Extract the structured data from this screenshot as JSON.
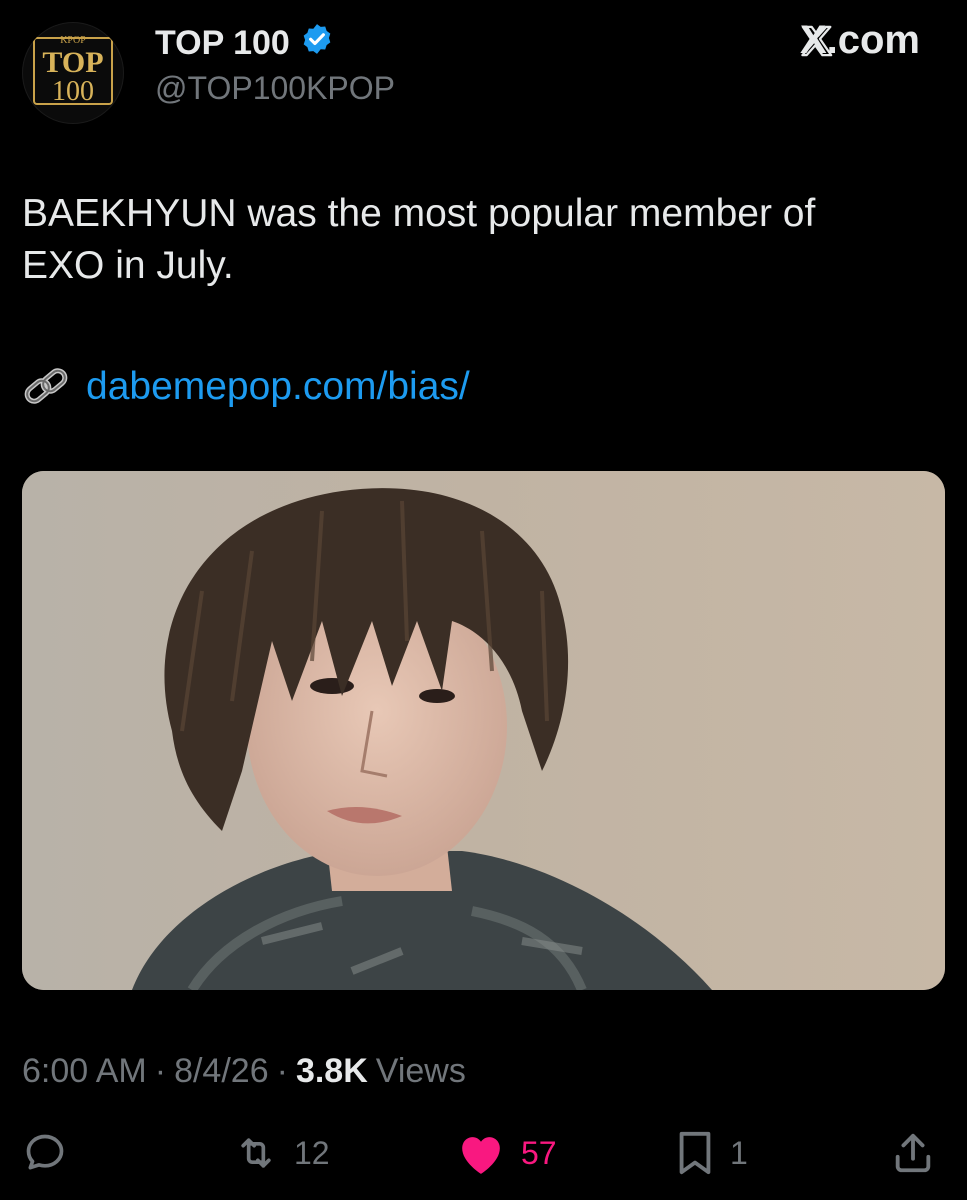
{
  "header": {
    "display_name": "TOP 100",
    "handle": "@TOP100KPOP",
    "verified_icon": "verified-badge-icon",
    "source_label": "X.com",
    "avatar": {
      "small_text": "KPOP",
      "big_text": "TOP",
      "number": "100"
    }
  },
  "tweet": {
    "text_line1": "BAEKHYUN was the most popular member of",
    "text_line2": "EXO in July.",
    "link_icon": "link-icon",
    "link": "dabemepop.com/bias/",
    "media_icon": "photo-of-baekhyun"
  },
  "meta": {
    "time": "6:00 AM",
    "sep1": "·",
    "date": "8/4/26",
    "sep2": "·",
    "views_count": "3.8K",
    "views_label": "Views"
  },
  "actions": {
    "reply_icon": "reply-icon",
    "retweet_icon": "retweet-icon",
    "retweet_count": "12",
    "like_icon": "heart-icon",
    "like_count": "57",
    "bookmark_icon": "bookmark-icon",
    "bookmark_count": "1",
    "share_icon": "share-icon"
  },
  "colors": {
    "background": "#000000",
    "text": "#e7e9ea",
    "muted": "#71767b",
    "link": "#1d9bf0",
    "like": "#f91880",
    "verified": "#1d9bf0",
    "avatar_gold": "#c9a24a"
  }
}
